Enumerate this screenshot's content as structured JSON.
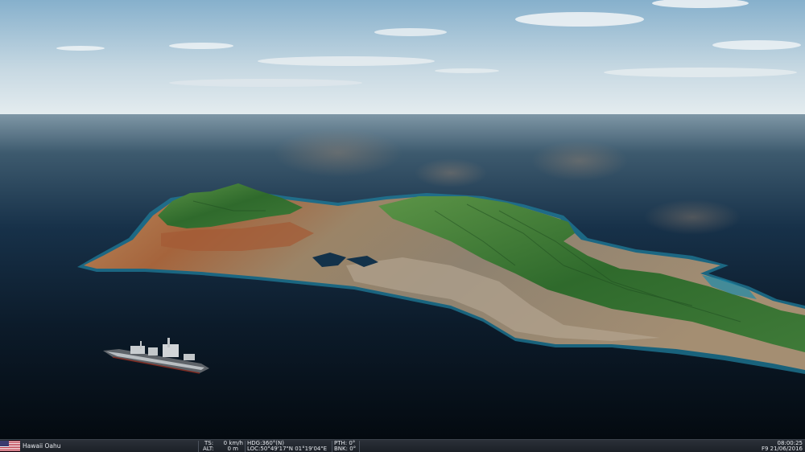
{
  "location": {
    "name": "Hawaii Oahu",
    "flag_icon": "us-flag-icon"
  },
  "telemetry": {
    "ts_label": "TS:",
    "ts_value": "0 km/h",
    "alt_label": "ALT:",
    "alt_value": "0 m",
    "hdg": "HDG:360°(N)",
    "loc": "LOC:50°49'17\"N 01°19'04\"E",
    "pth": "PTH: 0°",
    "bnk": "BNK: 0°"
  },
  "clock": {
    "time": "08:00:25",
    "date": "F9 21/06/2016"
  },
  "colors": {
    "statusbar_bg": "#23272e",
    "status_text": "#e6e9ee",
    "sky_top": "#8fb6d1",
    "ocean_deep": "#0a1622",
    "island_green": "#3f7a38"
  }
}
